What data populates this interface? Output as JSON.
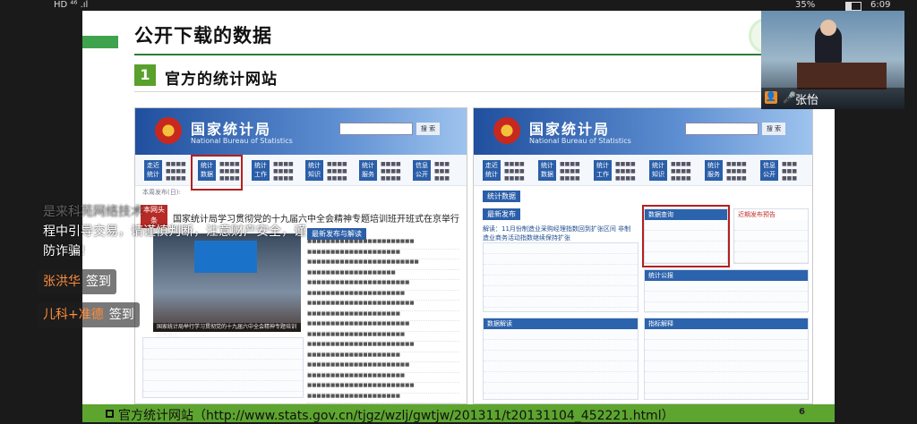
{
  "status_bar": {
    "left": "HD ⁴⁶ .ıl",
    "battery_text": "35%",
    "time": "6:09",
    "battery_level": 0.35
  },
  "slide": {
    "title": "公开下载的数据",
    "section_number": "1",
    "section_title": "官方的统计网站",
    "url_line": "官方统计网站（http://www.stats.gov.cn/tjgz/wzlj/gwtjw/201311/t20131104_452221.html）",
    "page_number": "6"
  },
  "left_shot": {
    "site_name": "国家统计局",
    "site_en": "National Bureau of Statistics",
    "search_btn": "搜 索",
    "nav": [
      "走近统计",
      "统计数据",
      "统计工作",
      "统计知识",
      "统计服务",
      "信息公开"
    ],
    "breadcrumb": "本周发布(日):",
    "news_tag": "本网头条",
    "headline": "国家统计局学习贯彻党的十九届六中全会精神专题培训班开班式在京举行",
    "photo_caption": "国家统计局举行学习贯彻党的十九届六中全会精神专题培训班开班式",
    "release_section": "最新发布与解读"
  },
  "right_shot": {
    "site_name": "国家统计局",
    "site_en": "National Bureau of Statistics",
    "search_btn": "搜 索",
    "nav": [
      "走近统计",
      "统计数据",
      "统计工作",
      "统计知识",
      "统计服务",
      "信息公开"
    ],
    "tab_stats": "统计数据",
    "latest": "最新发布",
    "highlight_title": "数据查询",
    "recent_release": "近期发布预告",
    "stats_bulletin": "统计公报",
    "data_interp": "数据解读",
    "indicator_interp": "指标解释",
    "lead_item": "解读：11月份制造业采购经理指数回到扩张区间 非制造业商务活动指数继续保持扩张"
  },
  "video": {
    "presenter": "张怡"
  },
  "danmaku": {
    "line1": "是来科苑网络技术",
    "line2": "程中引导交易，请谨慎判断，注意财产安全，谨",
    "line3": "防诈骗!",
    "chip1_name": "张洪华",
    "chip1_msg": "签到",
    "chip2_name": "儿科+准德",
    "chip2_msg": "签到"
  }
}
